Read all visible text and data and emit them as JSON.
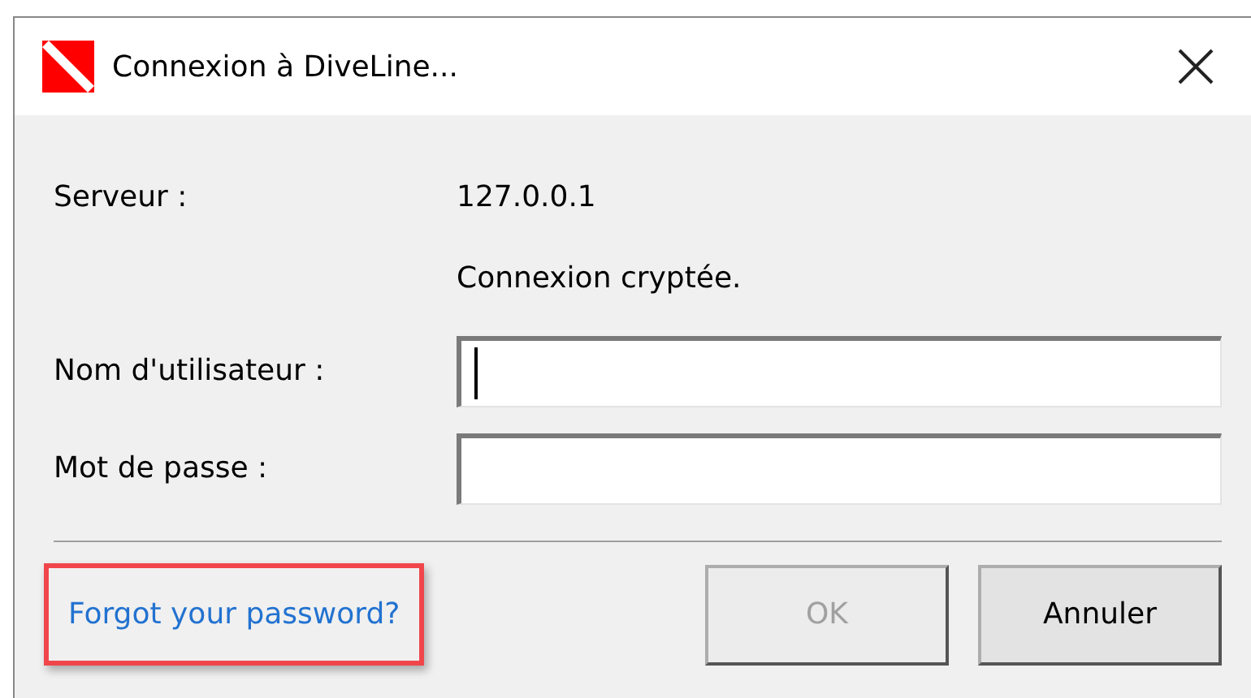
{
  "window": {
    "title": "Connexion à DiveLine..."
  },
  "info": [
    {
      "label": "Serveur :",
      "value": "127.0.0.1"
    },
    {
      "value": "Connexion cryptée."
    }
  ],
  "fields": [
    {
      "label": "Nom d'utilisateur :",
      "focused": true
    },
    {
      "label": "Mot de passe :",
      "focused": false
    }
  ],
  "link": {
    "label": "Forgot your password?",
    "highlighted": true
  },
  "buttons": [
    {
      "label": "OK",
      "disabled": true
    },
    {
      "label": "Annuler",
      "disabled": false
    }
  ]
}
